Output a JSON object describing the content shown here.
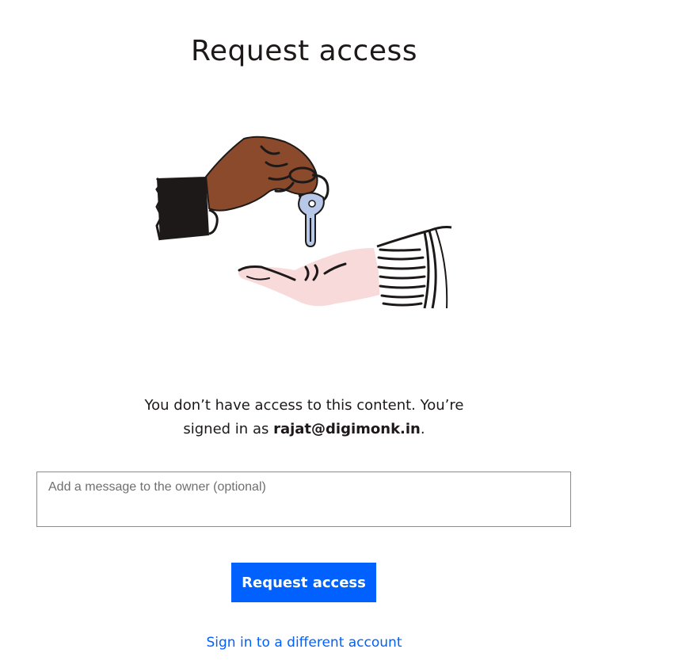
{
  "page": {
    "title": "Request access"
  },
  "message": {
    "line1": "You don’t have access to this content. You’re",
    "line2_prefix": "signed in as ",
    "email": "rajat@digimonk.in",
    "line2_suffix": "."
  },
  "owner_message": {
    "placeholder": "Add a message to the owner (optional)",
    "value": ""
  },
  "actions": {
    "request_label": "Request access",
    "switch_account_label": "Sign in to a different account"
  },
  "colors": {
    "accent": "#0061fe",
    "text": "#1e1919",
    "giver_skin": "#8b4a2c",
    "receiver_skin": "#f9dada",
    "key": "#b8c8e8"
  },
  "illustration": {
    "icon": "hand-passing-key-illustration"
  }
}
